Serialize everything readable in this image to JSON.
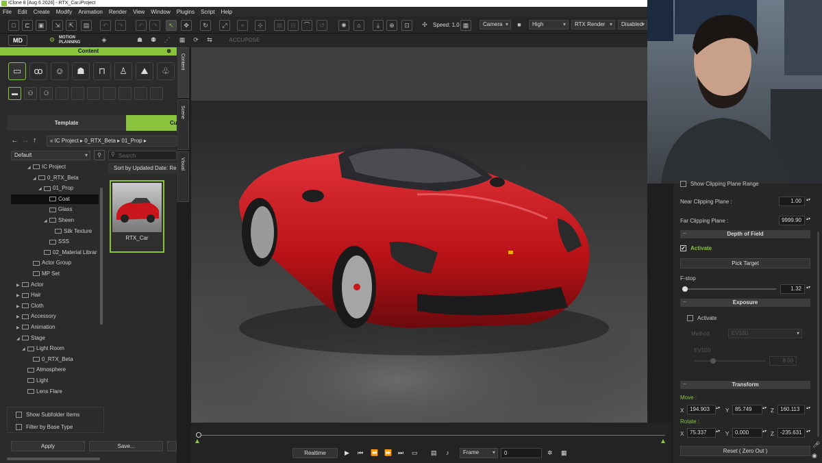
{
  "window": {
    "title": "iClone 8 [Aug 6 2026] - RTX_Car.iProject"
  },
  "menu": [
    "File",
    "Edit",
    "Create",
    "Modify",
    "Animation",
    "Render",
    "View",
    "Window",
    "Plugins",
    "Script",
    "Help"
  ],
  "toolbar": {
    "speed_label": "Speed: 1.0",
    "camera_value": "Camera",
    "quality_value": "High",
    "render_value": "RTX Render",
    "status_value": "Disabled",
    "motion_planning_label": "MOTION PLANNING",
    "accupose_label": "ACCUPOSE"
  },
  "content": {
    "title": "Content",
    "tabs": [
      "Template",
      "Cu"
    ],
    "breadcrumb": "« IC Project ▸ 0_RTX_Beta ▸ 01_Prop ▸",
    "filter_value": "Default",
    "search_placeholder": "Search",
    "sort_label": "Sort by Updated Date: Rece",
    "tree": [
      "IC Project",
      "0_RTX_Beta",
      "01_Prop",
      "Coat",
      "Glass",
      "Sheen",
      "Silk Texture",
      "SSS",
      "02_Material Librar",
      "Actor Group",
      "MP Set",
      "Actor",
      "Hair",
      "Cloth",
      "Accessory",
      "Animation",
      "Stage",
      "Light Room",
      "0_RTX_Beta",
      "Atmosphere",
      "Light",
      "Lens Flare"
    ],
    "thumbnail_label": "RTX_Car",
    "show_subfolder_label": "Show Subfolder Items",
    "filter_base_label": "Filter by Base Type",
    "apply_label": "Apply",
    "save_label": "Save...",
    "side_tabs": [
      "Content",
      "Scene",
      "Visual"
    ]
  },
  "timeline": {
    "realtime_label": "Realtime",
    "frame_label": "Frame",
    "frame_value": "0"
  },
  "properties": {
    "show_clipping_label": "Show Clipping Plane Range",
    "near_label": "Near Clipping Plane :",
    "near_value": "1.00",
    "far_label": "Far Clipping Plane :",
    "far_value": "9999.90",
    "dof_title": "Depth of Field",
    "dof_activate_label": "Activate",
    "pick_target_label": "Pick Target",
    "fstop_label": "F-stop",
    "fstop_value": "1.32",
    "exposure_title": "Exposure",
    "exposure_activate_label": "Activate",
    "method_label": "Method",
    "method_value": "EV100",
    "ev_label": "EV100",
    "ev_value": "8.00",
    "transform_title": "Transform",
    "move_label": "Move :",
    "move": {
      "x": "194.903",
      "y": "85.749",
      "z": "160.113"
    },
    "rotate_label": "Rotate :",
    "rotate": {
      "x": "75.337",
      "y": "0.000",
      "z": "-235.631"
    },
    "reset_label": "Reset ( Zero Out )",
    "axis_x": "X",
    "axis_y": "Y",
    "axis_z": "Z"
  },
  "colors": {
    "accent": "#8ac43f",
    "car": "#c8161c"
  },
  "fstop_slider_fraction": 0.02
}
